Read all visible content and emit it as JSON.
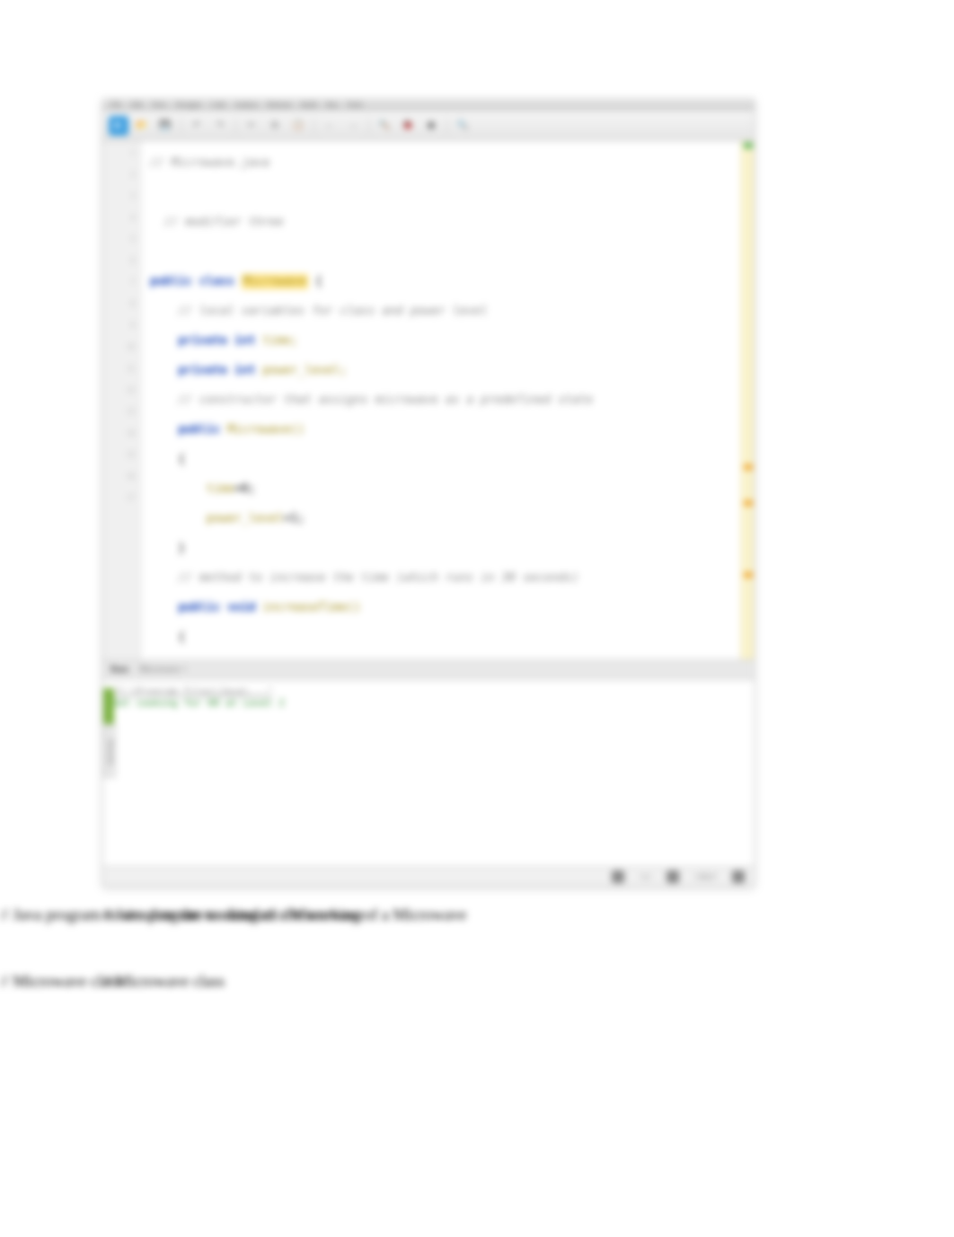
{
  "titlebar": {
    "items": [
      "File",
      "Edit",
      "View",
      "Navigate",
      "Code",
      "Analyze",
      "Refactor",
      "Build",
      "Run",
      "Tools"
    ]
  },
  "toolbar": {
    "play": "▶"
  },
  "code": {
    "lines": [
      {
        "type": "comment",
        "text": "// Microwave.java"
      },
      {
        "type": "blank",
        "text": ""
      },
      {
        "type": "comment",
        "text": "// modifier three"
      },
      {
        "type": "blank",
        "text": ""
      },
      {
        "type": "decl",
        "kw1": "public",
        "kw2": "class",
        "name": "Microwave",
        "brace": " {",
        "highlight": true
      },
      {
        "type": "comment",
        "text": "    // local variables for class and power level"
      },
      {
        "type": "field",
        "kw": "private int",
        "name": "time;"
      },
      {
        "type": "field",
        "kw": "private int",
        "name": "power_level;"
      },
      {
        "type": "comment",
        "text": "    // constructor that assigns microwave as a predefined state"
      },
      {
        "type": "ctor",
        "kw": "public",
        "name": "Microwave()"
      },
      {
        "type": "brace",
        "text": "    {"
      },
      {
        "type": "assign",
        "kw": "time",
        "rest": "=0;"
      },
      {
        "type": "assign",
        "kw": "power_level",
        "rest": "=1;"
      },
      {
        "type": "brace",
        "text": "    }"
      },
      {
        "type": "comment",
        "text": "    // method to increase the time (which runs in 30 seconds)"
      },
      {
        "type": "method",
        "kw1": "public",
        "kw2": "void",
        "name": "increaseTime()"
      },
      {
        "type": "brace",
        "text": "    {"
      }
    ]
  },
  "panel": {
    "tab_run": "Run:",
    "tab_name": "Microwave ×",
    "out1": "\"C:\\Program Files\\Java\\...\"",
    "out2": "Set cooking for 60 at Level 2"
  },
  "sidetab": "Structure",
  "status": {
    "pos": "1:1",
    "enc": "CRLF"
  },
  "text_below": {
    "line1": "// Java program to simulate the working of a Microwave",
    "line2": "// Microwave class"
  }
}
